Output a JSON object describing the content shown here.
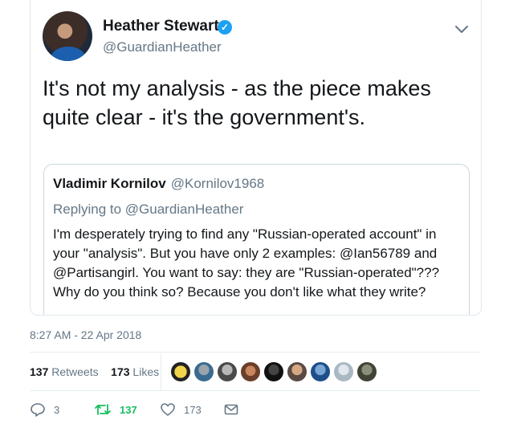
{
  "tweet": {
    "author_name": "Heather Stewart",
    "author_handle": "@GuardianHeather",
    "text": "It's not my analysis - as the piece makes quite clear - it's the government's.",
    "quoted": {
      "author_name": "Vladimir Kornilov",
      "author_handle": "@Kornilov1968",
      "replying_to": "Replying to @GuardianHeather",
      "text": "I'm desperately trying to find any \"Russian-operated account\" in your \"analysis\". But you have only 2 examples: @Ian56789 and @Partisangirl. You want to say: they are \"Russian-operated\"??? Why do you think so? Because you don't like what they write?"
    },
    "timestamp": "8:27 AM - 22 Apr 2018"
  },
  "stats": {
    "retweets_count": "137",
    "retweets_label": "Retweets",
    "likes_count": "173",
    "likes_label": "Likes"
  },
  "actions": {
    "reply_count": "3",
    "retweet_count": "137",
    "like_count": "173"
  },
  "colors": {
    "verified": "#1da1f2",
    "retweet_green": "#17bf63",
    "secondary_text": "#657786"
  },
  "icons": [
    "verified-badge-icon",
    "chevron-down-icon",
    "reply-icon",
    "retweet-icon",
    "heart-icon",
    "message-icon"
  ]
}
